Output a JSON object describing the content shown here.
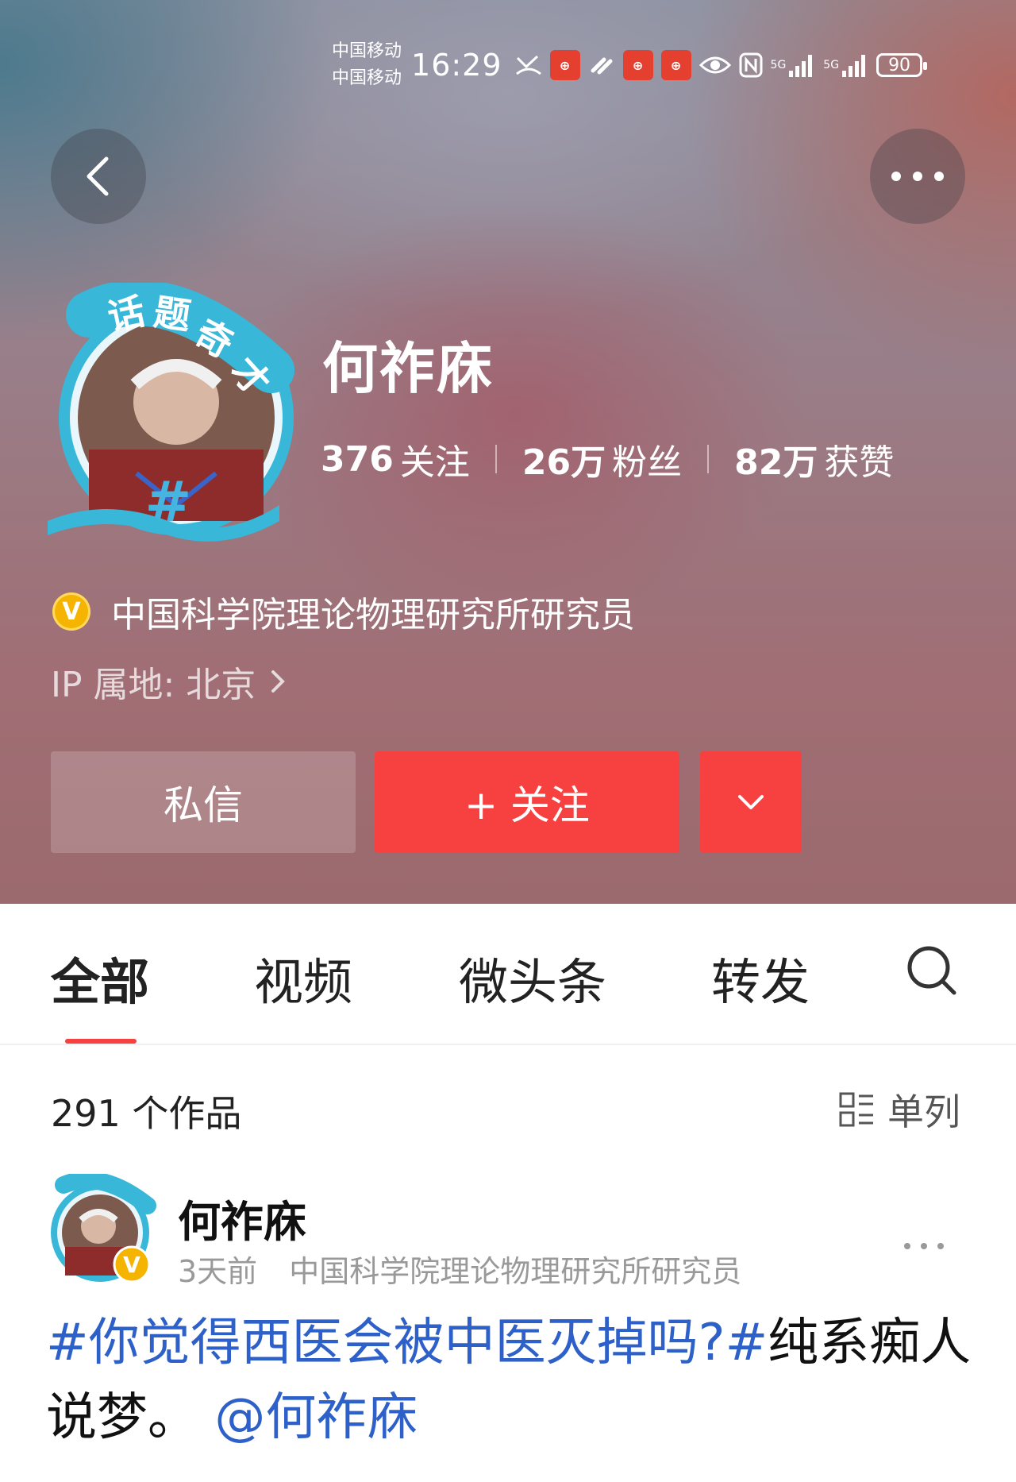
{
  "status_bar": {
    "carrier_1": "中国移动",
    "carrier_2": "中国移动",
    "time": "16:29",
    "network_1": "5G",
    "network_2": "5G",
    "battery": "90"
  },
  "profile": {
    "name": "何祚庥",
    "avatar_frame_text": "话题奇才",
    "stats": {
      "following_count": "376",
      "following_label": "关注",
      "fans_count": "26万",
      "fans_label": "粉丝",
      "likes_count": "82万",
      "likes_label": "获赞"
    },
    "verified_badge": "V",
    "verification": "中国科学院理论物理研究所研究员",
    "ip_location": "IP 属地: 北京",
    "buttons": {
      "message": "私信",
      "follow": "+ 关注"
    }
  },
  "tabs": [
    {
      "label": "全部",
      "active": true
    },
    {
      "label": "视频",
      "active": false
    },
    {
      "label": "微头条",
      "active": false
    },
    {
      "label": "转发",
      "active": false
    }
  ],
  "works": {
    "count_label": "291 个作品",
    "layout_label": "单列"
  },
  "post": {
    "author": "何祚庥",
    "time": "3天前",
    "author_title": "中国科学院理论物理研究所研究员",
    "topic": "#你觉得西医会被中医灭掉吗?#",
    "text": "纯系痴人说梦。",
    "mention": "@何祚庥"
  },
  "colors": {
    "accent_red": "#f74040",
    "link_blue": "#2d60c8",
    "verified_gold": "#f4b400"
  },
  "icons": [
    "back-icon",
    "more-icon",
    "chevron-down-icon",
    "search-icon",
    "list-layout-icon",
    "chevron-right-icon",
    "verified-icon"
  ]
}
